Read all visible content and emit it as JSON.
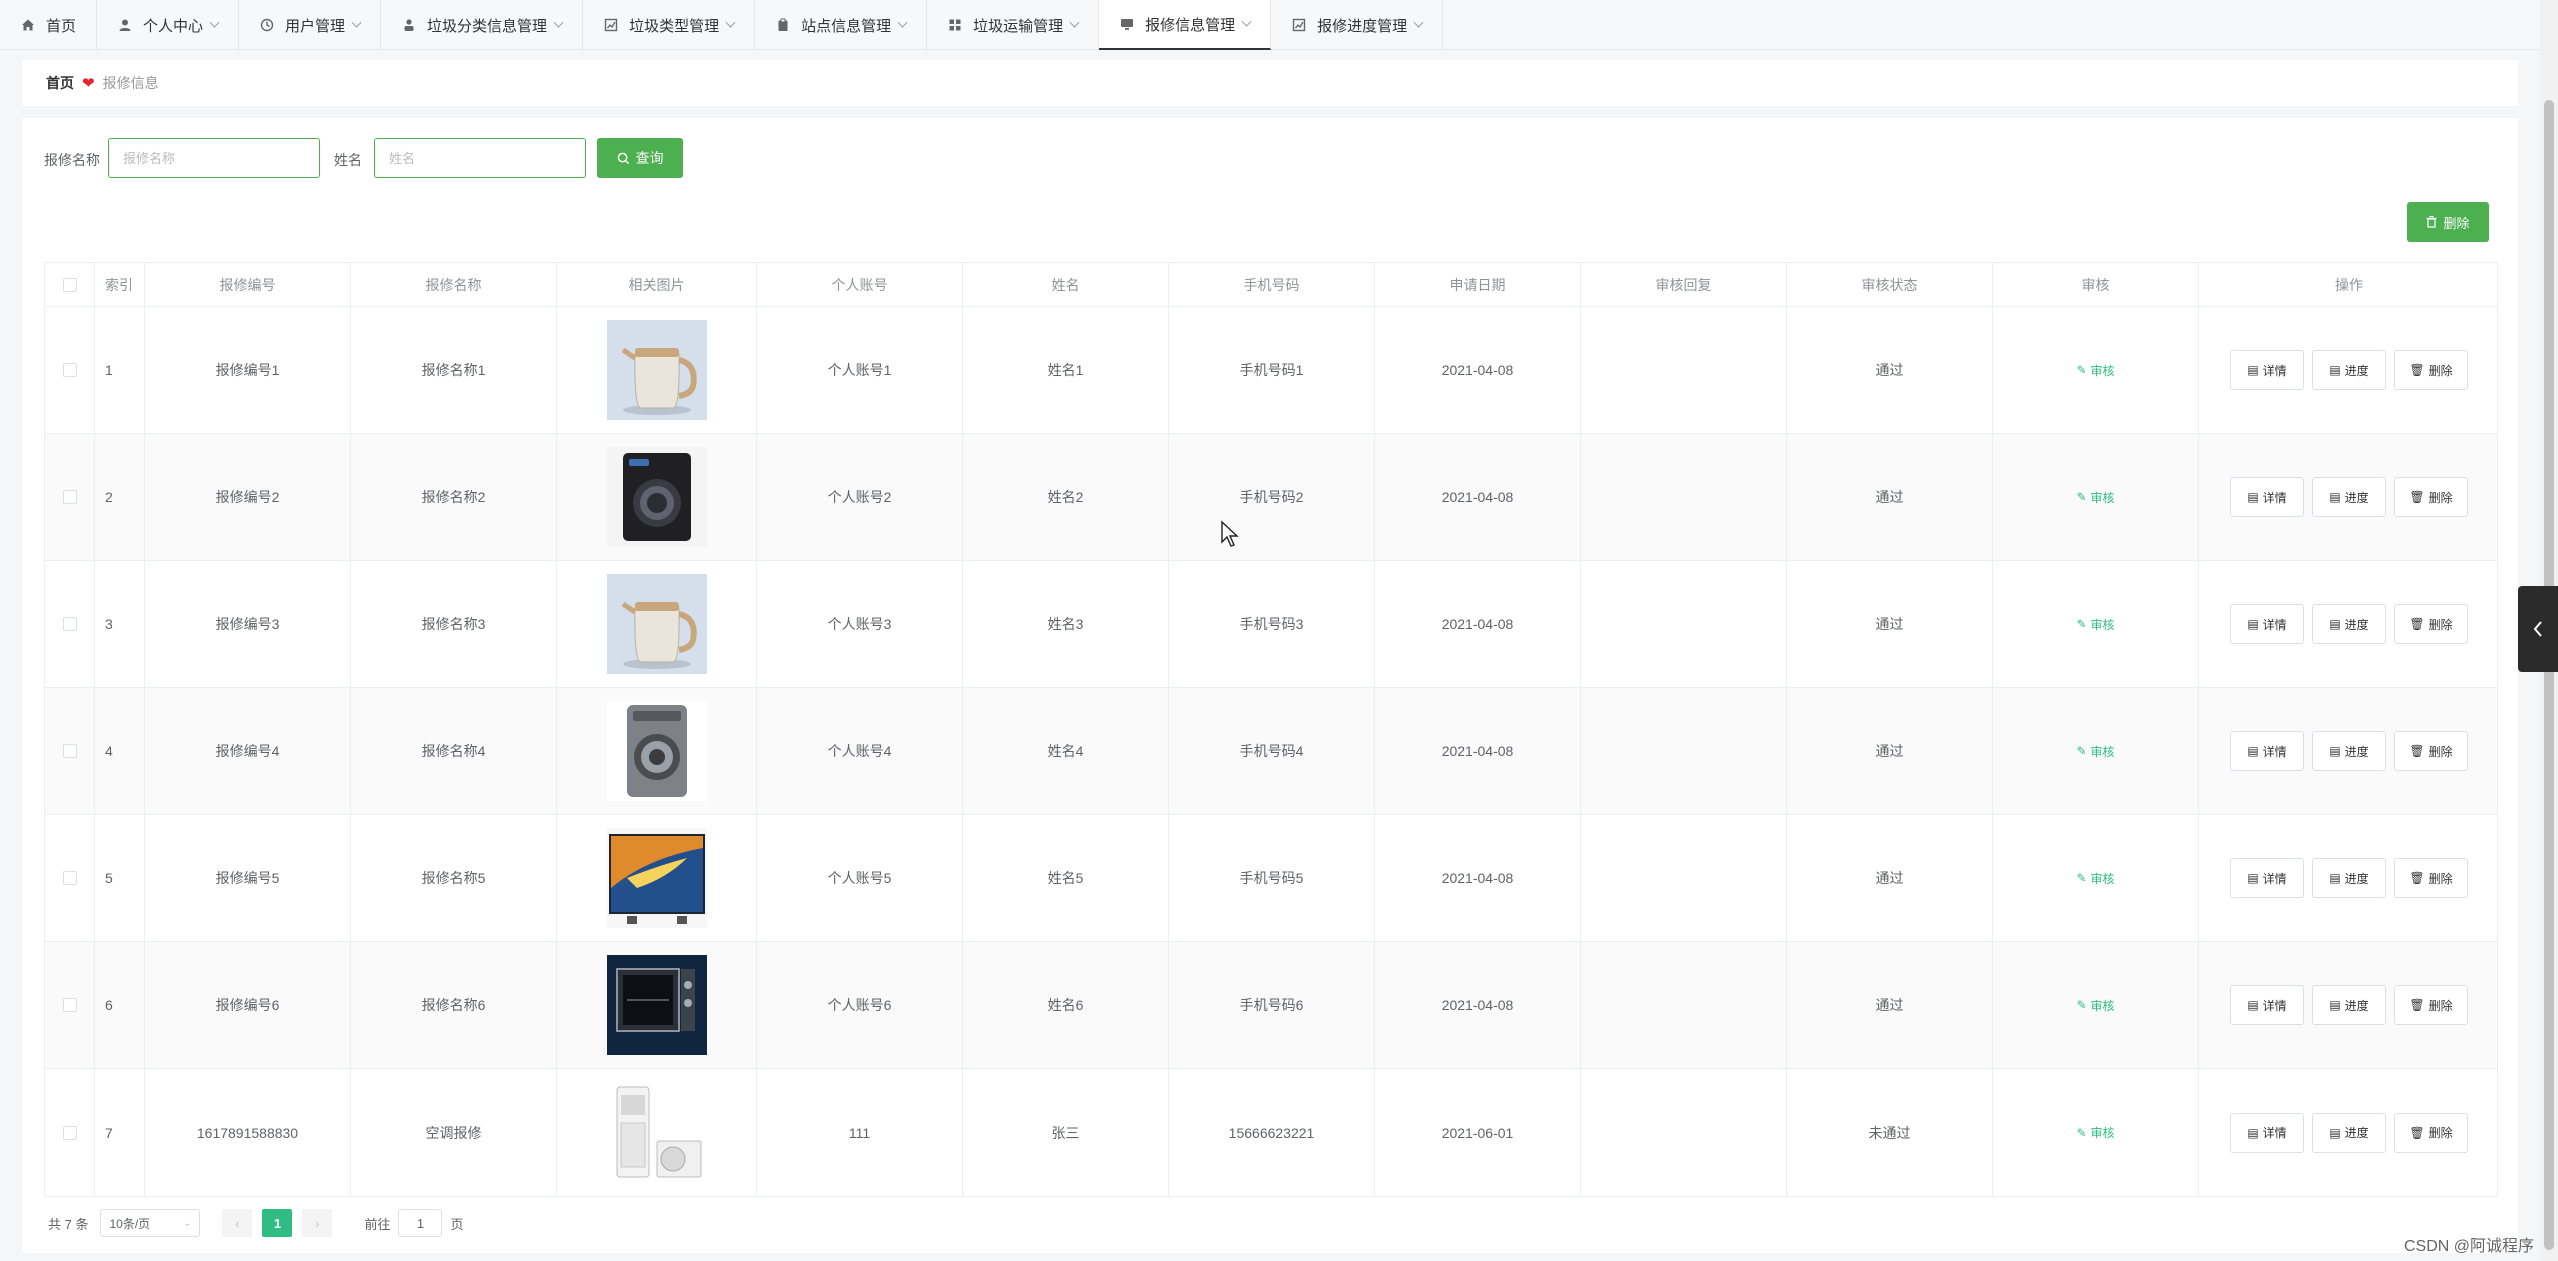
{
  "nav": [
    {
      "label": "首页",
      "icon": "home-icon",
      "dropdown": false,
      "active": false
    },
    {
      "label": "个人中心",
      "icon": "user-icon",
      "dropdown": true,
      "active": false
    },
    {
      "label": "用户管理",
      "icon": "clock-icon",
      "dropdown": true,
      "active": false
    },
    {
      "label": "垃圾分类信息管理",
      "icon": "person-icon",
      "dropdown": true,
      "active": false
    },
    {
      "label": "垃圾类型管理",
      "icon": "chart-icon",
      "dropdown": true,
      "active": false
    },
    {
      "label": "站点信息管理",
      "icon": "clipboard-icon",
      "dropdown": true,
      "active": false
    },
    {
      "label": "垃圾运输管理",
      "icon": "grid-icon",
      "dropdown": true,
      "active": false
    },
    {
      "label": "报修信息管理",
      "icon": "monitor-icon",
      "dropdown": true,
      "active": true
    },
    {
      "label": "报修进度管理",
      "icon": "chart-icon",
      "dropdown": true,
      "active": false
    }
  ],
  "breadcrumb": {
    "home": "首页",
    "current": "报修信息"
  },
  "search": {
    "label1": "报修名称",
    "placeholder1": "报修名称",
    "label2": "姓名",
    "placeholder2": "姓名",
    "button": "查询"
  },
  "toolbar": {
    "delete_label": "删除"
  },
  "table": {
    "headers": [
      "索引",
      "报修编号",
      "报修名称",
      "相关图片",
      "个人账号",
      "姓名",
      "手机号码",
      "申请日期",
      "审核回复",
      "审核状态",
      "审核",
      "操作"
    ],
    "audit_label": "审核",
    "actions": [
      "详情",
      "进度",
      "删除"
    ],
    "rows": [
      {
        "index": "1",
        "code": "报修编号1",
        "name": "报修名称1",
        "image": "kettle",
        "account": "个人账号1",
        "person": "姓名1",
        "phone": "手机号码1",
        "date": "2021-04-08",
        "reply": "",
        "status": "通过"
      },
      {
        "index": "2",
        "code": "报修编号2",
        "name": "报修名称2",
        "image": "washer-dark",
        "account": "个人账号2",
        "person": "姓名2",
        "phone": "手机号码2",
        "date": "2021-04-08",
        "reply": "",
        "status": "通过"
      },
      {
        "index": "3",
        "code": "报修编号3",
        "name": "报修名称3",
        "image": "kettle",
        "account": "个人账号3",
        "person": "姓名3",
        "phone": "手机号码3",
        "date": "2021-04-08",
        "reply": "",
        "status": "通过"
      },
      {
        "index": "4",
        "code": "报修编号4",
        "name": "报修名称4",
        "image": "washer-grey",
        "account": "个人账号4",
        "person": "姓名4",
        "phone": "手机号码4",
        "date": "2021-04-08",
        "reply": "",
        "status": "通过"
      },
      {
        "index": "5",
        "code": "报修编号5",
        "name": "报修名称5",
        "image": "tv",
        "account": "个人账号5",
        "person": "姓名5",
        "phone": "手机号码5",
        "date": "2021-04-08",
        "reply": "",
        "status": "通过"
      },
      {
        "index": "6",
        "code": "报修编号6",
        "name": "报修名称6",
        "image": "oven",
        "account": "个人账号6",
        "person": "姓名6",
        "phone": "手机号码6",
        "date": "2021-04-08",
        "reply": "",
        "status": "通过"
      },
      {
        "index": "7",
        "code": "1617891588830",
        "name": "空调报修",
        "image": "air-conditioner",
        "account": "111",
        "person": "张三",
        "phone": "15666623221",
        "date": "2021-06-01",
        "reply": "",
        "status": "未通过"
      }
    ]
  },
  "pagination": {
    "total": "共 7 条",
    "page_size": "10条/页",
    "current": "1",
    "goto_label": "前往",
    "goto_value": "1",
    "page_suffix": "页"
  },
  "watermark": "CSDN @阿诚程序",
  "colors": {
    "primary": "#4caf50",
    "accent": "#2fbd84",
    "heart": "#e4262c"
  }
}
